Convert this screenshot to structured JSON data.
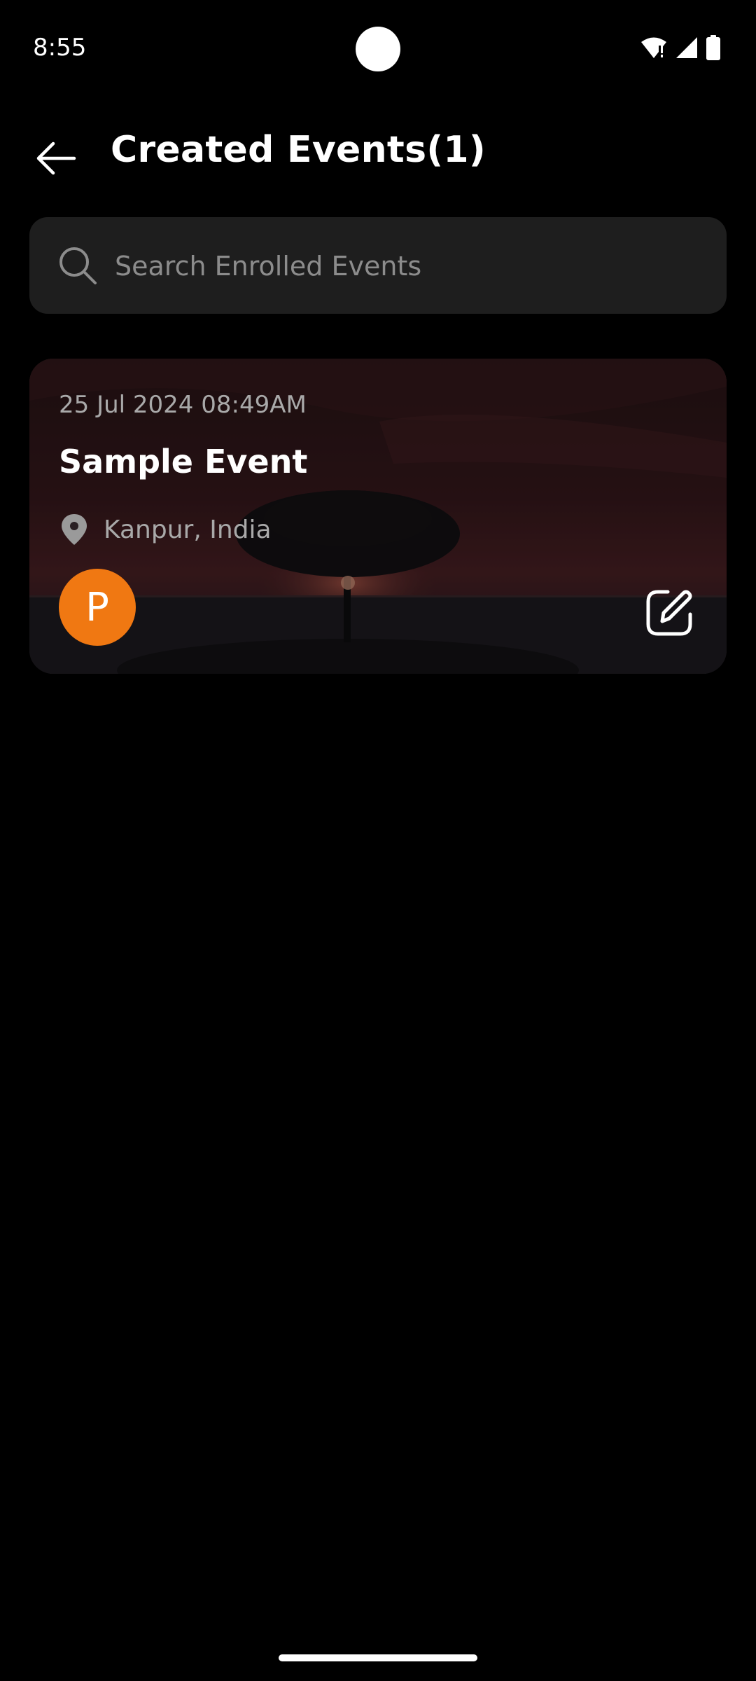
{
  "status_bar": {
    "time": "8:55",
    "icons": [
      "wifi-alert-icon",
      "signal-icon",
      "battery-icon"
    ]
  },
  "header": {
    "back_icon": "arrow-left-icon",
    "title": "Created Events(1)"
  },
  "search": {
    "icon": "search-icon",
    "placeholder": "Search Enrolled Events",
    "value": ""
  },
  "events": [
    {
      "date": "25 Jul 2024 08:49AM",
      "title": "Sample Event",
      "location_icon": "location-pin-icon",
      "location": "Kanpur, India",
      "avatar_initial": "P",
      "avatar_color": "#f07812",
      "edit_icon": "edit-icon"
    }
  ],
  "colors": {
    "background": "#000000",
    "surface": "#1e1e1e",
    "accent": "#f07812",
    "muted_text": "#a9a9a9"
  }
}
